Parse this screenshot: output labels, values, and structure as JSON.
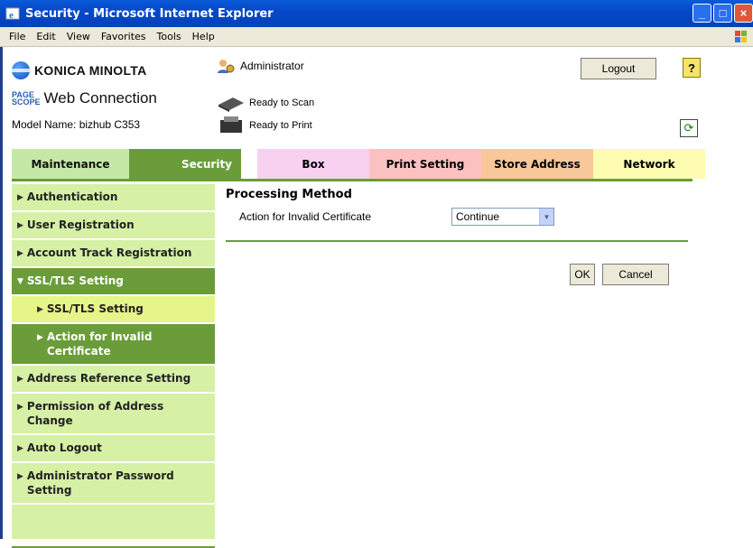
{
  "window": {
    "title": "Security - Microsoft Internet Explorer"
  },
  "menu": [
    "File",
    "Edit",
    "View",
    "Favorites",
    "Tools",
    "Help"
  ],
  "header": {
    "brand": "KONICA MINOLTA",
    "pagescope_top": "PAGE",
    "pagescope_bottom": "SCOPE",
    "web_connection": "Web Connection",
    "model": "Model Name: bizhub C353",
    "user": "Administrator",
    "logout": "Logout",
    "help": "?",
    "scan_status": "Ready to Scan",
    "print_status": "Ready to Print"
  },
  "tabs": {
    "maintenance": "Maintenance",
    "security": "Security",
    "box": "Box",
    "print_setting": "Print Setting",
    "store_address": "Store Address",
    "network": "Network"
  },
  "sidebar": {
    "authentication": "Authentication",
    "user_registration": "User Registration",
    "account_track": "Account Track Registration",
    "ssl_tls": "SSL/TLS Setting",
    "ssl_tls_sub": "SSL/TLS Setting",
    "action_invalid": "Action for Invalid Certificate",
    "address_ref": "Address Reference Setting",
    "permission_addr": "Permission of Address Change",
    "auto_logout": "Auto Logout",
    "admin_pw": "Administrator Password Setting"
  },
  "main": {
    "section_title": "Processing Method",
    "field_label": "Action for Invalid Certificate",
    "field_value": "Continue",
    "ok": "OK",
    "cancel": "Cancel"
  },
  "colors": {
    "accent": "#6a9d3a",
    "sidebar": "#d6f0a5",
    "selected": "#e6f58a"
  },
  "icons": [
    "ie-icon",
    "xp-logo-icon",
    "admin-icon",
    "scanner-icon",
    "printer-icon",
    "refresh-icon",
    "help-icon"
  ]
}
